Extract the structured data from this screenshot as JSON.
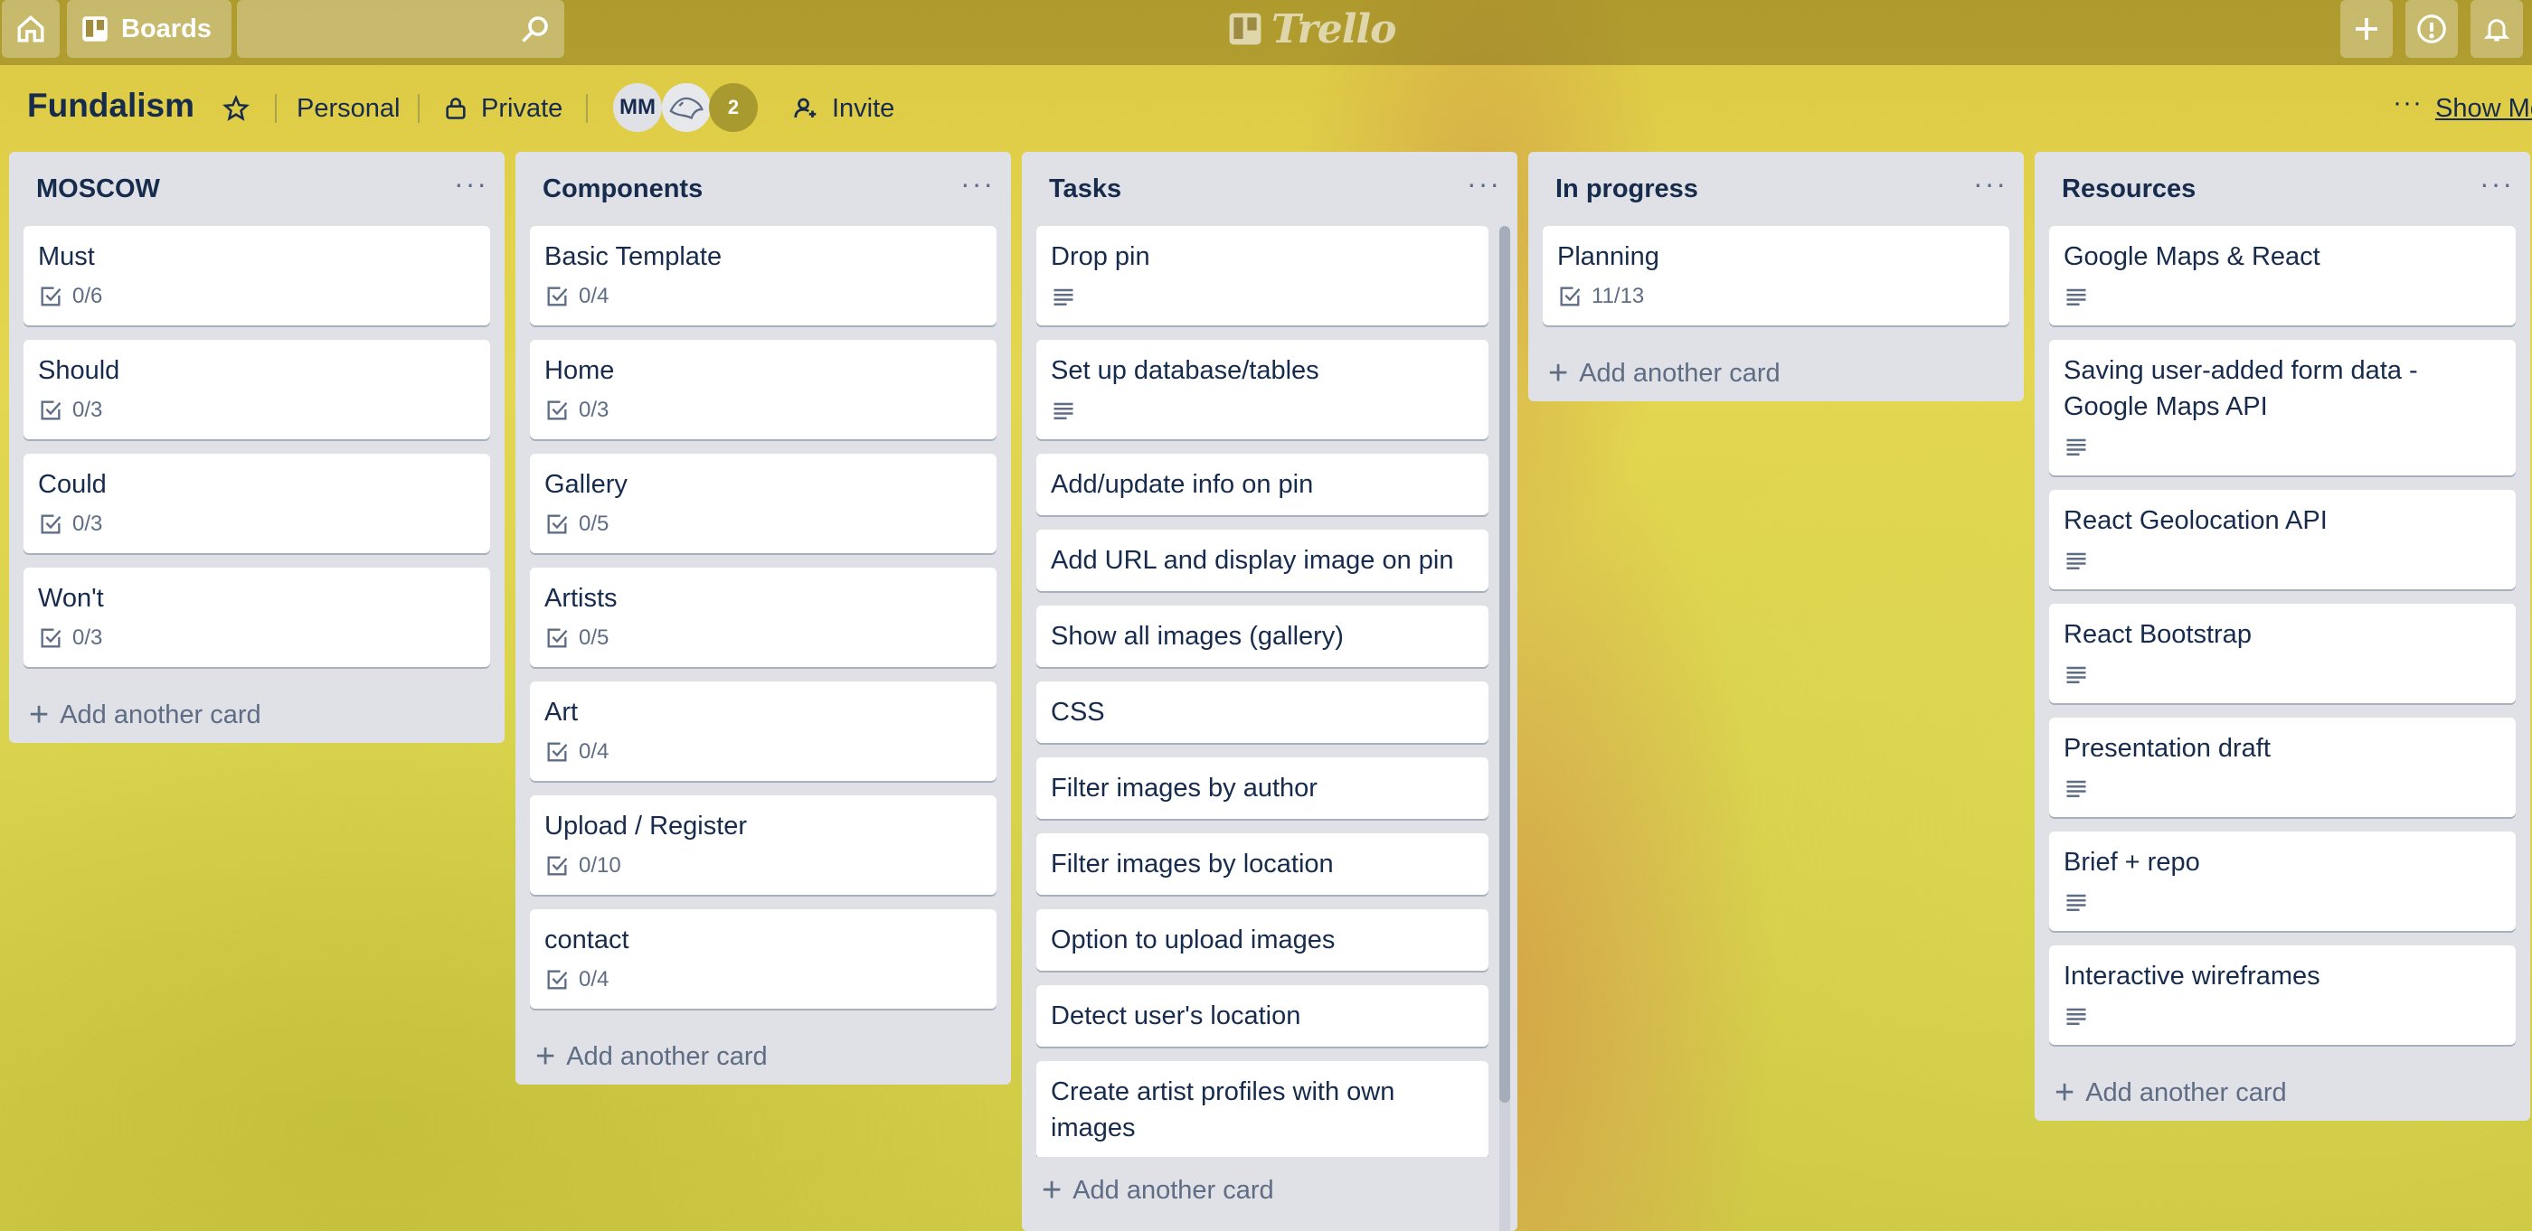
{
  "header": {
    "boards_label": "Boards",
    "logo_text": "Trello",
    "search_value": ""
  },
  "board": {
    "title": "Fundalism",
    "visibility_team": "Personal",
    "visibility": "Private",
    "members": {
      "initials": "MM",
      "extra_count": "2"
    },
    "invite_label": "Invite",
    "show_menu_label": "Show Menu"
  },
  "lists": [
    {
      "title": "MOSCOW",
      "cards": [
        {
          "title": "Must",
          "checklist": "0/6"
        },
        {
          "title": "Should",
          "checklist": "0/3"
        },
        {
          "title": "Could",
          "checklist": "0/3"
        },
        {
          "title": "Won't",
          "checklist": "0/3"
        }
      ],
      "add_label": "Add another card"
    },
    {
      "title": "Components",
      "cards": [
        {
          "title": "Basic Template",
          "checklist": "0/4"
        },
        {
          "title": "Home",
          "checklist": "0/3"
        },
        {
          "title": "Gallery",
          "checklist": "0/5"
        },
        {
          "title": "Artists",
          "checklist": "0/5"
        },
        {
          "title": "Art",
          "checklist": "0/4"
        },
        {
          "title": "Upload / Register",
          "checklist": "0/10"
        },
        {
          "title": "contact",
          "checklist": "0/4"
        }
      ],
      "add_label": "Add another card"
    },
    {
      "title": "Tasks",
      "cards": [
        {
          "title": "Drop pin",
          "description": true
        },
        {
          "title": "Set up database/tables",
          "description": true
        },
        {
          "title": "Add/update info on pin"
        },
        {
          "title": "Add URL and display image on pin"
        },
        {
          "title": "Show all images (gallery)"
        },
        {
          "title": "CSS"
        },
        {
          "title": "Filter images by author"
        },
        {
          "title": "Filter images by location"
        },
        {
          "title": "Option to upload images"
        },
        {
          "title": "Detect user's location"
        },
        {
          "title": "Create artist profiles with own images"
        }
      ],
      "add_label": "Add another card"
    },
    {
      "title": "In progress",
      "cards": [
        {
          "title": "Planning",
          "checklist": "11/13"
        }
      ],
      "add_label": "Add another card"
    },
    {
      "title": "Resources",
      "cards": [
        {
          "title": "Google Maps & React",
          "description": true
        },
        {
          "title": "Saving user-added form data - Google Maps API",
          "description": true
        },
        {
          "title": "React Geolocation API",
          "description": true
        },
        {
          "title": "React Bootstrap",
          "description": true
        },
        {
          "title": "Presentation draft",
          "description": true
        },
        {
          "title": "Brief + repo",
          "description": true
        },
        {
          "title": "Interactive wireframes",
          "description": true
        }
      ],
      "add_label": "Add another card"
    }
  ]
}
